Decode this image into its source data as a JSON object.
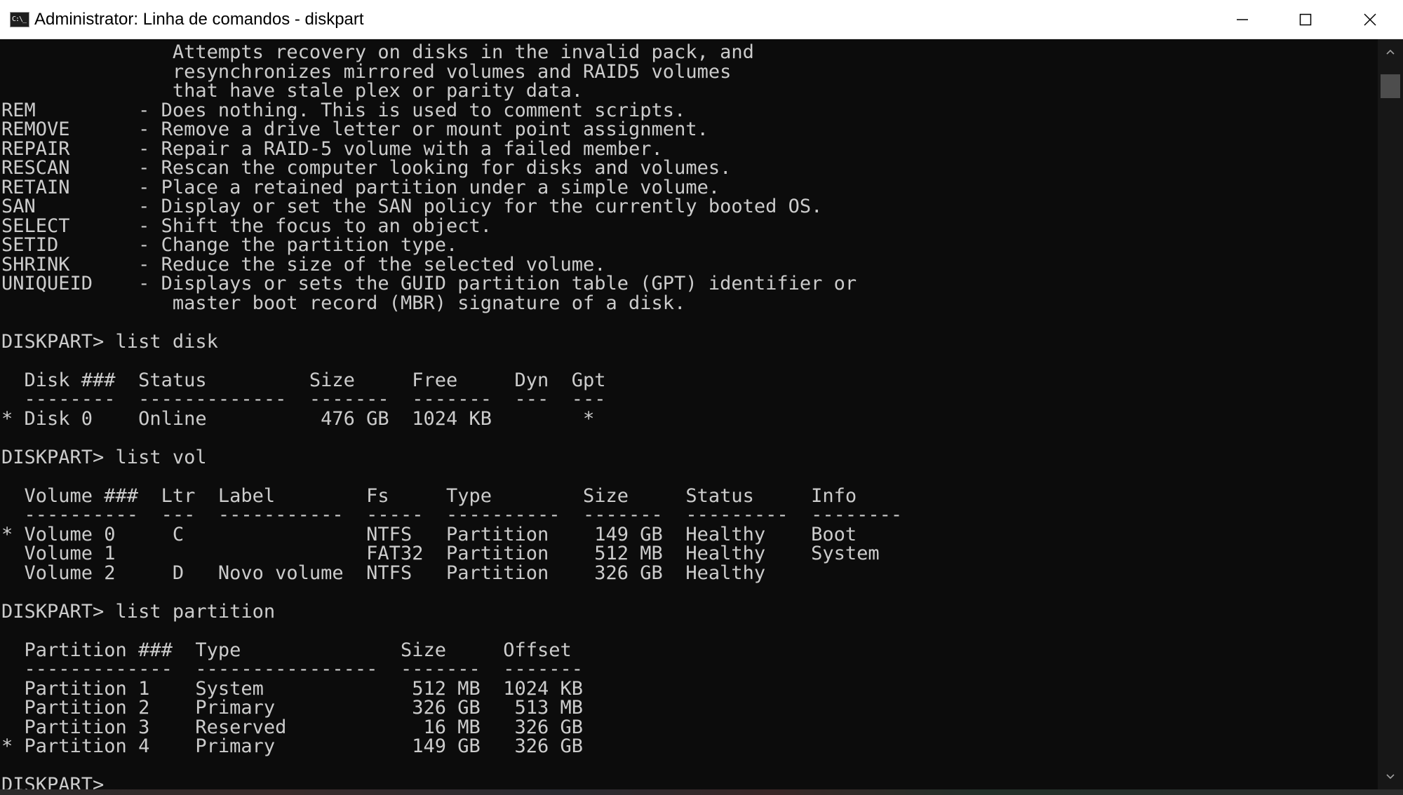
{
  "window": {
    "title": "Administrator: Linha de comandos - diskpart",
    "app_icon_text": "C:\\_"
  },
  "console": {
    "lines": [
      "               Attempts recovery on disks in the invalid pack, and",
      "               resynchronizes mirrored volumes and RAID5 volumes",
      "               that have stale plex or parity data.",
      "REM         - Does nothing. This is used to comment scripts.",
      "REMOVE      - Remove a drive letter or mount point assignment.",
      "REPAIR      - Repair a RAID-5 volume with a failed member.",
      "RESCAN      - Rescan the computer looking for disks and volumes.",
      "RETAIN      - Place a retained partition under a simple volume.",
      "SAN         - Display or set the SAN policy for the currently booted OS.",
      "SELECT      - Shift the focus to an object.",
      "SETID       - Change the partition type.",
      "SHRINK      - Reduce the size of the selected volume.",
      "UNIQUEID    - Displays or sets the GUID partition table (GPT) identifier or",
      "               master boot record (MBR) signature of a disk.",
      "",
      "DISKPART> list disk",
      "",
      "  Disk ###  Status         Size     Free     Dyn  Gpt",
      "  --------  -------------  -------  -------  ---  ---",
      "* Disk 0    Online          476 GB  1024 KB        *",
      "",
      "DISKPART> list vol",
      "",
      "  Volume ###  Ltr  Label        Fs     Type        Size     Status     Info",
      "  ----------  ---  -----------  -----  ----------  -------  ---------  --------",
      "* Volume 0     C                NTFS   Partition    149 GB  Healthy    Boot",
      "  Volume 1                      FAT32  Partition    512 MB  Healthy    System",
      "  Volume 2     D   Novo volume  NTFS   Partition    326 GB  Healthy",
      "",
      "DISKPART> list partition",
      "",
      "  Partition ###  Type              Size     Offset",
      "  -------------  ----------------  -------  -------",
      "  Partition 1    System             512 MB  1024 KB",
      "  Partition 2    Primary            326 GB   513 MB",
      "  Partition 3    Reserved            16 MB   326 GB",
      "* Partition 4    Primary            149 GB   326 GB",
      "",
      "DISKPART> "
    ]
  },
  "colors": {
    "console_background": "#0c0c0c",
    "console_foreground": "#cccccc",
    "titlebar_background": "#ffffff"
  },
  "icons": {
    "minimize": "minimize-icon",
    "maximize": "maximize-icon",
    "close": "close-icon",
    "scroll_up": "chevron-up-icon",
    "scroll_down": "chevron-down-icon"
  }
}
